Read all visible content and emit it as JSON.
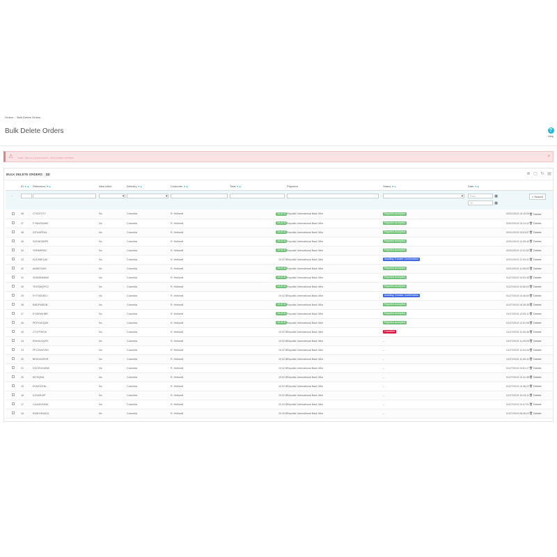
{
  "breadcrumb": [
    "Orders",
    "Bulk Delete Orders"
  ],
  "page_title": "Bulk Delete Orders",
  "help_label": "Help",
  "alert_text": "Note: this is a permanent, irreversible deletion",
  "panel": {
    "title": "BULK DELETE ORDERS",
    "count": "23"
  },
  "columns": [
    "ID",
    "Reference",
    "New client",
    "Delivery",
    "Customer",
    "Total",
    "Payment",
    "Status",
    "Date"
  ],
  "filters": {
    "date_from_placeholder": "From",
    "date_to_placeholder": "To",
    "search_label": "Search"
  },
  "delete_label": "Delete",
  "colors": {
    "green": "#72c279",
    "blue": "#4169e1",
    "red": "#dc143c",
    "alert_bg": "#fbe3e4",
    "accent": "#25b9d7"
  },
  "rows": [
    {
      "id": "38",
      "reference": "CTVDTVTY",
      "new_client": "No",
      "delivery": "Colombia",
      "customer": "R. Helbwell",
      "total": "19,02 $",
      "total_pill": true,
      "payment": "Republic International Bank Wire",
      "status": "Payment accepted",
      "status_color": "#72c279",
      "date": "02/01/2019 15:15:00"
    },
    {
      "id": "37",
      "reference": "FYNWGWWE",
      "new_client": "No",
      "delivery": "Colombia",
      "customer": "R. Helbwell",
      "total": "19,02 $",
      "total_pill": true,
      "payment": "Republic International Bank Wire",
      "status": "Payment accepted",
      "status_color": "#72c279",
      "date": "02/01/2019 15:13:12"
    },
    {
      "id": "36",
      "reference": "DITUAFPWL",
      "new_client": "No",
      "delivery": "Colombia",
      "customer": "R. Helbwell",
      "total": "19,02 $",
      "total_pill": true,
      "payment": "Republic International Bank Wire",
      "status": "Payment accepted",
      "status_color": "#72c279",
      "date": "02/01/2019 15:03:57"
    },
    {
      "id": "35",
      "reference": "SOKNDDBPE",
      "new_client": "No",
      "delivery": "Colombia",
      "customer": "R. Helbwell",
      "total": "19,02 $",
      "total_pill": true,
      "payment": "Republic International Bank Wire",
      "status": "Payment accepted",
      "status_color": "#72c279",
      "date": "02/01/2019 12:05:40"
    },
    {
      "id": "34",
      "reference": "YRRMPPNC",
      "new_client": "No",
      "delivery": "Colombia",
      "customer": "R. Helbwell",
      "total": "19,02 $",
      "total_pill": true,
      "payment": "Republic International Bank Wire",
      "status": "Payment accepted",
      "status_color": "#72c279",
      "date": "02/01/2019 12:01:02"
    },
    {
      "id": "33",
      "reference": "EUDSBKLAK",
      "new_client": "No",
      "delivery": "Colombia",
      "customer": "R. Helbwell",
      "total": "19,02 $",
      "total_pill": false,
      "payment": "Republic International Bank Wire",
      "status": "Awaiting Transfer Confirmation",
      "status_color": "#4169e1",
      "date": "02/01/2019 12:03:41"
    },
    {
      "id": "32",
      "reference": "AHIEEGWG",
      "new_client": "No",
      "delivery": "Colombia",
      "customer": "R. Helbwell",
      "total": "19,02 $",
      "total_pill": true,
      "payment": "Republic International Bank Wire",
      "status": "Payment accepted",
      "status_color": "#72c279",
      "date": "02/01/2019 11:59:02"
    },
    {
      "id": "31",
      "reference": "SDMWMMBM",
      "new_client": "No",
      "delivery": "Colombia",
      "customer": "R. Helbwell",
      "total": "19,02 $",
      "total_pill": true,
      "payment": "Republic International Bank Wire",
      "status": "Payment accepted",
      "status_color": "#72c279",
      "date": "01/27/2019 10:53:45"
    },
    {
      "id": "30",
      "reference": "TEGSMOPCZ",
      "new_client": "No",
      "delivery": "Colombia",
      "customer": "R. Helbwell",
      "total": "19,02 $",
      "total_pill": true,
      "payment": "Republic International Bank Wire",
      "status": "Payment accepted",
      "status_color": "#72c279",
      "date": "01/27/2019 10:50:02"
    },
    {
      "id": "29",
      "reference": "EYTNGDEEJ",
      "new_client": "No",
      "delivery": "Colombia",
      "customer": "R. Helbwell",
      "total": "19,02 $",
      "total_pill": false,
      "payment": "Republic International Bank Wire",
      "status": "Awaiting Transfer Confirmation",
      "status_color": "#4169e1",
      "date": "01/27/2019 10:46:00"
    },
    {
      "id": "28",
      "reference": "EMDPWEDB",
      "new_client": "No",
      "delivery": "Colombia",
      "customer": "R. Helbwell",
      "total": "19,02 $",
      "total_pill": true,
      "payment": "Republic International Bank Wire",
      "status": "Payment accepted",
      "status_color": "#72c279",
      "date": "01/27/2019 10:39:36"
    },
    {
      "id": "27",
      "reference": "EYWRWHBR",
      "new_client": "No",
      "delivery": "Colombia",
      "customer": "R. Helbwell",
      "total": "19,02 $",
      "total_pill": true,
      "payment": "Republic International Bank Wire",
      "status": "Payment accepted",
      "status_color": "#72c279",
      "date": "01/27/2019 12:05:11"
    },
    {
      "id": "26",
      "reference": "PEPXUUQDE",
      "new_client": "No",
      "delivery": "Colombia",
      "customer": "R. Helbwell",
      "total": "19,02 $",
      "total_pill": true,
      "payment": "Republic International Bank Wire",
      "status": "Payment accepted",
      "status_color": "#72c279",
      "date": "01/27/2019 12:01:05"
    },
    {
      "id": "25",
      "reference": "CTVPFHIVE",
      "new_client": "No",
      "delivery": "Colombia",
      "customer": "R. Helbwell",
      "total": "19,02 $",
      "total_pill": false,
      "payment": "Republic International Bank Wire",
      "status": "Canceled",
      "status_color": "#dc143c",
      "date": "01/27/2019 11:05:36"
    },
    {
      "id": "24",
      "reference": "ENHXUOQFE",
      "new_client": "No",
      "delivery": "Colombia",
      "customer": "R. Helbwell",
      "total": "19,02 $",
      "total_pill": false,
      "payment": "Republic International Bank Wire",
      "status": "--",
      "status_color": "",
      "date": "01/27/2019 11:05:25"
    },
    {
      "id": "23",
      "reference": "PFCZWKVRG",
      "new_client": "No",
      "delivery": "Colombia",
      "customer": "R. Helbwell",
      "total": "19,02 $",
      "total_pill": false,
      "payment": "Republic International Bank Wire",
      "status": "--",
      "status_color": "",
      "date": "01/27/2019 11:04:44"
    },
    {
      "id": "22",
      "reference": "BEHOAKRVR",
      "new_client": "No",
      "delivery": "Colombia",
      "customer": "R. Helbwell",
      "total": "19,02 $",
      "total_pill": false,
      "payment": "Republic International Bank Wire",
      "status": "--",
      "status_color": "",
      "date": "01/27/2019 11:00:41"
    },
    {
      "id": "21",
      "reference": "DOCRVGARW",
      "new_client": "No",
      "delivery": "Colombia",
      "customer": "R. Helbwell",
      "total": "19,02 $",
      "total_pill": false,
      "payment": "Republic International Bank Wire",
      "status": "--",
      "status_color": "",
      "date": "01/27/2019 10:51:17"
    },
    {
      "id": "20",
      "reference": "KDYIQNIL",
      "new_client": "No",
      "delivery": "Colombia",
      "customer": "R. Helbwell",
      "total": "19,02 $",
      "total_pill": false,
      "payment": "Republic International Bank Wire",
      "status": "--",
      "status_color": "",
      "date": "01/27/2019 10:41:38"
    },
    {
      "id": "19",
      "reference": "EUMGCENL",
      "new_client": "No",
      "delivery": "Colombia",
      "customer": "R. Helbwell",
      "total": "19,02 $",
      "total_pill": false,
      "payment": "Republic International Bank Wire",
      "status": "--",
      "status_color": "",
      "date": "01/27/2019 10:36:22"
    },
    {
      "id": "18",
      "reference": "IUYNGUZP",
      "new_client": "No",
      "delivery": "Colombia",
      "customer": "R. Helbwell",
      "total": "19,02 $",
      "total_pill": false,
      "payment": "Republic International Bank Wire",
      "status": "--",
      "status_color": "",
      "date": "01/27/2019 10:43:11"
    },
    {
      "id": "17",
      "reference": "CUAUNGMIA",
      "new_client": "No",
      "delivery": "Colombia",
      "customer": "R. Helbwell",
      "total": "20,04 $",
      "total_pill": false,
      "payment": "Republic International Bank Wire",
      "status": "--",
      "status_color": "",
      "date": "01/27/2019 10:47:01"
    },
    {
      "id": "16",
      "reference": "EWEXHNUDX",
      "new_client": "No",
      "delivery": "Colombia",
      "customer": "R. Helbwell",
      "total": "20,30 $",
      "total_pill": false,
      "payment": "Republic International Bank Wire",
      "status": "--",
      "status_color": "",
      "date": "01/27/2019 06:06:22"
    }
  ]
}
